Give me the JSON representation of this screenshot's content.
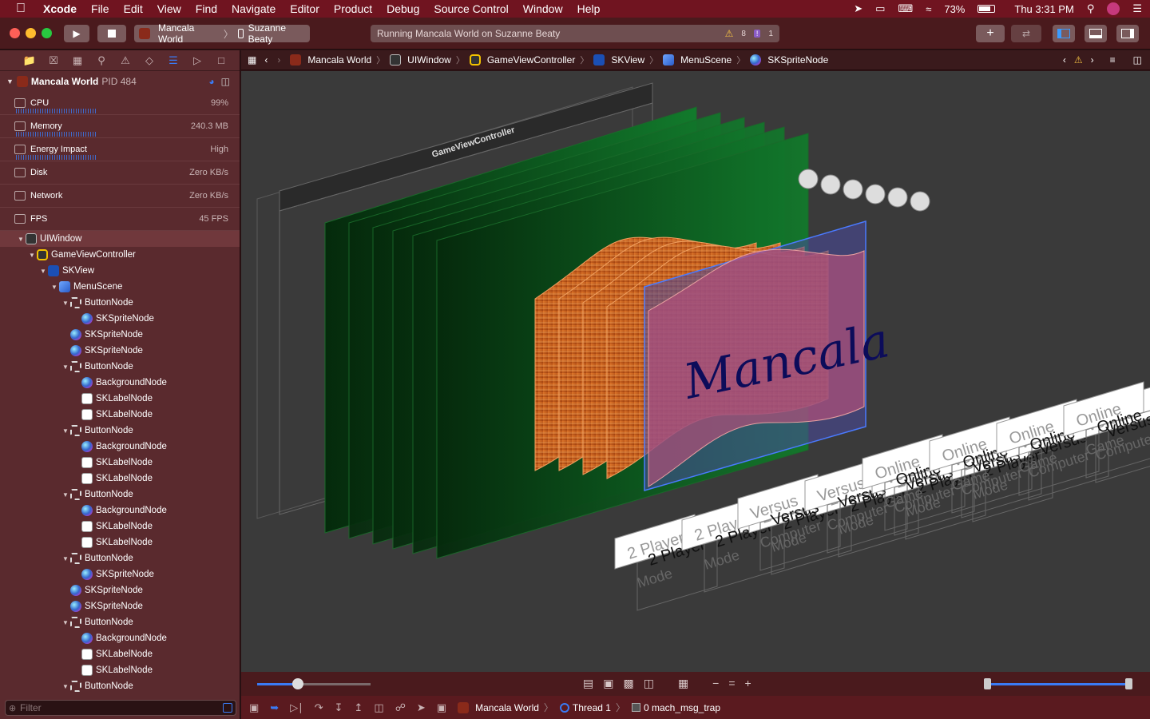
{
  "menubar": {
    "app_name": "Xcode",
    "items": [
      "File",
      "Edit",
      "View",
      "Find",
      "Navigate",
      "Editor",
      "Product",
      "Debug",
      "Source Control",
      "Window",
      "Help"
    ],
    "battery": "73%",
    "clock": "Thu 3:31 PM"
  },
  "toolbar": {
    "scheme": "Mancala World",
    "device": "Suzanne Beaty",
    "activity": "Running Mancala World on Suzanne Beaty",
    "warnings": "8",
    "issues": "1"
  },
  "navigator": {
    "process": {
      "name": "Mancala World",
      "pid": "PID 484"
    },
    "gauges": [
      {
        "label": "CPU",
        "value": "99%"
      },
      {
        "label": "Memory",
        "value": "240.3 MB"
      },
      {
        "label": "Energy Impact",
        "value": "High"
      },
      {
        "label": "Disk",
        "value": "Zero KB/s"
      },
      {
        "label": "Network",
        "value": "Zero KB/s"
      },
      {
        "label": "FPS",
        "value": "45 FPS"
      }
    ],
    "tree": [
      {
        "label": "UIWindow",
        "icon": "window-icon",
        "depth": 0,
        "open": true
      },
      {
        "label": "GameViewController",
        "icon": "view-controller-icon",
        "depth": 1,
        "open": true
      },
      {
        "label": "SKView",
        "icon": "skview-icon",
        "depth": 2,
        "open": true
      },
      {
        "label": "MenuScene",
        "icon": "scene-icon",
        "depth": 3,
        "open": true
      },
      {
        "label": "ButtonNode",
        "icon": "button-node-icon",
        "depth": 4,
        "open": true
      },
      {
        "label": "SKSpriteNode",
        "icon": "sprite-node-icon",
        "depth": 5
      },
      {
        "label": "SKSpriteNode",
        "icon": "sprite-node-icon",
        "depth": 4
      },
      {
        "label": "SKSpriteNode",
        "icon": "sprite-node-icon",
        "depth": 4
      },
      {
        "label": "ButtonNode",
        "icon": "button-node-icon",
        "depth": 4,
        "open": true
      },
      {
        "label": "BackgroundNode",
        "icon": "sprite-node-icon",
        "depth": 5
      },
      {
        "label": "SKLabelNode",
        "icon": "label-node-icon",
        "depth": 5
      },
      {
        "label": "SKLabelNode",
        "icon": "label-node-icon",
        "depth": 5
      },
      {
        "label": "ButtonNode",
        "icon": "button-node-icon",
        "depth": 4,
        "open": true
      },
      {
        "label": "BackgroundNode",
        "icon": "sprite-node-icon",
        "depth": 5
      },
      {
        "label": "SKLabelNode",
        "icon": "label-node-icon",
        "depth": 5
      },
      {
        "label": "SKLabelNode",
        "icon": "label-node-icon",
        "depth": 5
      },
      {
        "label": "ButtonNode",
        "icon": "button-node-icon",
        "depth": 4,
        "open": true
      },
      {
        "label": "BackgroundNode",
        "icon": "sprite-node-icon",
        "depth": 5
      },
      {
        "label": "SKLabelNode",
        "icon": "label-node-icon",
        "depth": 5
      },
      {
        "label": "SKLabelNode",
        "icon": "label-node-icon",
        "depth": 5
      },
      {
        "label": "ButtonNode",
        "icon": "button-node-icon",
        "depth": 4,
        "open": true
      },
      {
        "label": "SKSpriteNode",
        "icon": "sprite-node-icon",
        "depth": 5
      },
      {
        "label": "SKSpriteNode",
        "icon": "sprite-node-icon",
        "depth": 4
      },
      {
        "label": "SKSpriteNode",
        "icon": "sprite-node-icon",
        "depth": 4
      },
      {
        "label": "ButtonNode",
        "icon": "button-node-icon",
        "depth": 4,
        "open": true
      },
      {
        "label": "BackgroundNode",
        "icon": "sprite-node-icon",
        "depth": 5
      },
      {
        "label": "SKLabelNode",
        "icon": "label-node-icon",
        "depth": 5
      },
      {
        "label": "SKLabelNode",
        "icon": "label-node-icon",
        "depth": 5
      },
      {
        "label": "ButtonNode",
        "icon": "button-node-icon",
        "depth": 4,
        "open": true
      }
    ],
    "filter_placeholder": "Filter"
  },
  "jumpbar": {
    "crumbs": [
      "Mancala World",
      "UIWindow",
      "GameViewController",
      "SKView",
      "MenuScene",
      "SKSpriteNode"
    ]
  },
  "canvas": {
    "window_title": "GameViewController",
    "logo_text": "Mancala",
    "button_labels": [
      "2 Player",
      "Mode",
      "Versus",
      "Computer",
      "Online",
      "Game"
    ]
  },
  "debugbar": {
    "process": "Mancala World",
    "thread": "Thread 1",
    "frame": "0 mach_msg_trap"
  },
  "colors": {
    "menubar": "#701420",
    "accent": "#3a7bf5",
    "green_layer": "#0d5a20",
    "wood": "#c2521a"
  }
}
